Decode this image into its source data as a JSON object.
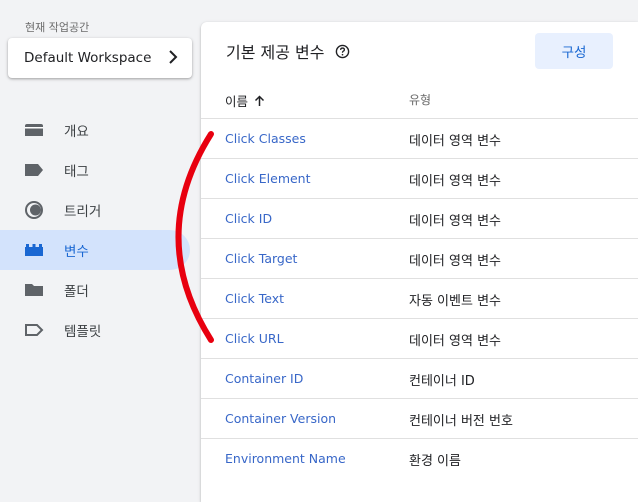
{
  "workspace": {
    "label": "현재 작업공간",
    "name": "Default Workspace"
  },
  "nav": {
    "items": [
      {
        "label": "개요",
        "icon": "folder-tab-icon"
      },
      {
        "label": "태그",
        "icon": "tag-icon"
      },
      {
        "label": "트리거",
        "icon": "trigger-icon"
      },
      {
        "label": "변수",
        "icon": "variables-icon",
        "active": true
      },
      {
        "label": "폴더",
        "icon": "folder-icon"
      },
      {
        "label": "템플릿",
        "icon": "template-icon"
      }
    ]
  },
  "panel": {
    "title": "기본 제공 변수",
    "config_label": "구성",
    "col_name": "이름",
    "col_type": "유형",
    "rows": [
      {
        "name": "Click Classes",
        "type": "데이터 영역 변수"
      },
      {
        "name": "Click Element",
        "type": "데이터 영역 변수"
      },
      {
        "name": "Click ID",
        "type": "데이터 영역 변수"
      },
      {
        "name": "Click Target",
        "type": "데이터 영역 변수"
      },
      {
        "name": "Click Text",
        "type": "자동 이벤트 변수"
      },
      {
        "name": "Click URL",
        "type": "데이터 영역 변수"
      },
      {
        "name": "Container ID",
        "type": "컨테이너 ID"
      },
      {
        "name": "Container Version",
        "type": "컨테이너 버전 번호"
      },
      {
        "name": "Environment Name",
        "type": "환경 이름"
      }
    ]
  },
  "colors": {
    "accent": "#1967d2",
    "active_bg": "#d3e3fc",
    "link": "#3867c8",
    "annotation": "#e8000f"
  }
}
